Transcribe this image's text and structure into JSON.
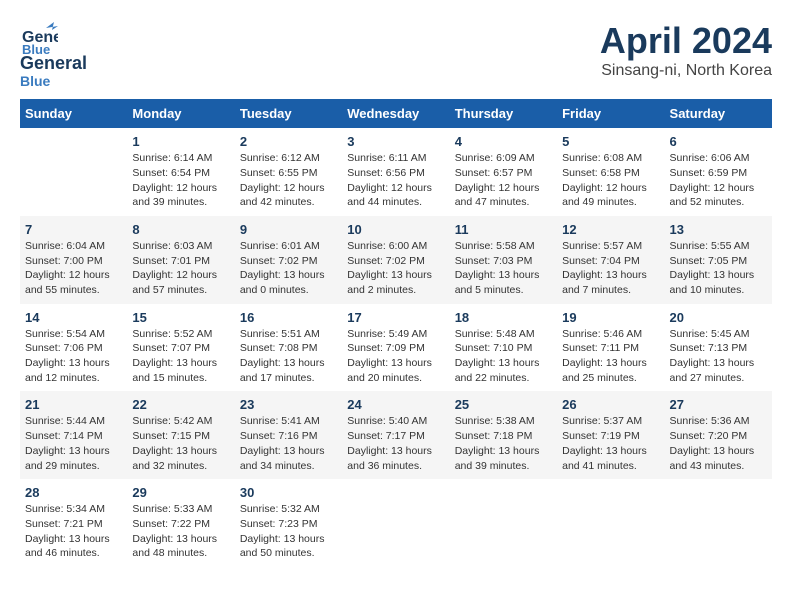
{
  "header": {
    "logo_general": "General",
    "logo_blue": "Blue",
    "main_title": "April 2024",
    "subtitle": "Sinsang-ni, North Korea"
  },
  "columns": [
    "Sunday",
    "Monday",
    "Tuesday",
    "Wednesday",
    "Thursday",
    "Friday",
    "Saturday"
  ],
  "weeks": [
    [
      {
        "day": "",
        "info": ""
      },
      {
        "day": "1",
        "info": "Sunrise: 6:14 AM\nSunset: 6:54 PM\nDaylight: 12 hours\nand 39 minutes."
      },
      {
        "day": "2",
        "info": "Sunrise: 6:12 AM\nSunset: 6:55 PM\nDaylight: 12 hours\nand 42 minutes."
      },
      {
        "day": "3",
        "info": "Sunrise: 6:11 AM\nSunset: 6:56 PM\nDaylight: 12 hours\nand 44 minutes."
      },
      {
        "day": "4",
        "info": "Sunrise: 6:09 AM\nSunset: 6:57 PM\nDaylight: 12 hours\nand 47 minutes."
      },
      {
        "day": "5",
        "info": "Sunrise: 6:08 AM\nSunset: 6:58 PM\nDaylight: 12 hours\nand 49 minutes."
      },
      {
        "day": "6",
        "info": "Sunrise: 6:06 AM\nSunset: 6:59 PM\nDaylight: 12 hours\nand 52 minutes."
      }
    ],
    [
      {
        "day": "7",
        "info": "Sunrise: 6:04 AM\nSunset: 7:00 PM\nDaylight: 12 hours\nand 55 minutes."
      },
      {
        "day": "8",
        "info": "Sunrise: 6:03 AM\nSunset: 7:01 PM\nDaylight: 12 hours\nand 57 minutes."
      },
      {
        "day": "9",
        "info": "Sunrise: 6:01 AM\nSunset: 7:02 PM\nDaylight: 13 hours\nand 0 minutes."
      },
      {
        "day": "10",
        "info": "Sunrise: 6:00 AM\nSunset: 7:02 PM\nDaylight: 13 hours\nand 2 minutes."
      },
      {
        "day": "11",
        "info": "Sunrise: 5:58 AM\nSunset: 7:03 PM\nDaylight: 13 hours\nand 5 minutes."
      },
      {
        "day": "12",
        "info": "Sunrise: 5:57 AM\nSunset: 7:04 PM\nDaylight: 13 hours\nand 7 minutes."
      },
      {
        "day": "13",
        "info": "Sunrise: 5:55 AM\nSunset: 7:05 PM\nDaylight: 13 hours\nand 10 minutes."
      }
    ],
    [
      {
        "day": "14",
        "info": "Sunrise: 5:54 AM\nSunset: 7:06 PM\nDaylight: 13 hours\nand 12 minutes."
      },
      {
        "day": "15",
        "info": "Sunrise: 5:52 AM\nSunset: 7:07 PM\nDaylight: 13 hours\nand 15 minutes."
      },
      {
        "day": "16",
        "info": "Sunrise: 5:51 AM\nSunset: 7:08 PM\nDaylight: 13 hours\nand 17 minutes."
      },
      {
        "day": "17",
        "info": "Sunrise: 5:49 AM\nSunset: 7:09 PM\nDaylight: 13 hours\nand 20 minutes."
      },
      {
        "day": "18",
        "info": "Sunrise: 5:48 AM\nSunset: 7:10 PM\nDaylight: 13 hours\nand 22 minutes."
      },
      {
        "day": "19",
        "info": "Sunrise: 5:46 AM\nSunset: 7:11 PM\nDaylight: 13 hours\nand 25 minutes."
      },
      {
        "day": "20",
        "info": "Sunrise: 5:45 AM\nSunset: 7:13 PM\nDaylight: 13 hours\nand 27 minutes."
      }
    ],
    [
      {
        "day": "21",
        "info": "Sunrise: 5:44 AM\nSunset: 7:14 PM\nDaylight: 13 hours\nand 29 minutes."
      },
      {
        "day": "22",
        "info": "Sunrise: 5:42 AM\nSunset: 7:15 PM\nDaylight: 13 hours\nand 32 minutes."
      },
      {
        "day": "23",
        "info": "Sunrise: 5:41 AM\nSunset: 7:16 PM\nDaylight: 13 hours\nand 34 minutes."
      },
      {
        "day": "24",
        "info": "Sunrise: 5:40 AM\nSunset: 7:17 PM\nDaylight: 13 hours\nand 36 minutes."
      },
      {
        "day": "25",
        "info": "Sunrise: 5:38 AM\nSunset: 7:18 PM\nDaylight: 13 hours\nand 39 minutes."
      },
      {
        "day": "26",
        "info": "Sunrise: 5:37 AM\nSunset: 7:19 PM\nDaylight: 13 hours\nand 41 minutes."
      },
      {
        "day": "27",
        "info": "Sunrise: 5:36 AM\nSunset: 7:20 PM\nDaylight: 13 hours\nand 43 minutes."
      }
    ],
    [
      {
        "day": "28",
        "info": "Sunrise: 5:34 AM\nSunset: 7:21 PM\nDaylight: 13 hours\nand 46 minutes."
      },
      {
        "day": "29",
        "info": "Sunrise: 5:33 AM\nSunset: 7:22 PM\nDaylight: 13 hours\nand 48 minutes."
      },
      {
        "day": "30",
        "info": "Sunrise: 5:32 AM\nSunset: 7:23 PM\nDaylight: 13 hours\nand 50 minutes."
      },
      {
        "day": "",
        "info": ""
      },
      {
        "day": "",
        "info": ""
      },
      {
        "day": "",
        "info": ""
      },
      {
        "day": "",
        "info": ""
      }
    ]
  ]
}
